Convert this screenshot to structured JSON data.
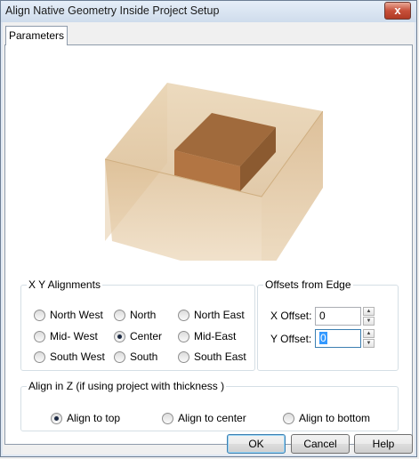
{
  "window": {
    "title": "Align Native Geometry Inside Project Setup",
    "close_glyph": "x"
  },
  "tabs": [
    {
      "label": "Parameters",
      "selected": true
    }
  ],
  "xy_alignments": {
    "legend": "X Y Alignments",
    "options": [
      {
        "label": "North West",
        "checked": false
      },
      {
        "label": "North",
        "checked": false
      },
      {
        "label": "North East",
        "checked": false
      },
      {
        "label": "Mid- West",
        "checked": false
      },
      {
        "label": "Center",
        "checked": true
      },
      {
        "label": "Mid-East",
        "checked": false
      },
      {
        "label": "South West",
        "checked": false
      },
      {
        "label": "South",
        "checked": false
      },
      {
        "label": "South East",
        "checked": false
      }
    ]
  },
  "offsets": {
    "legend": "Offsets from Edge",
    "x_label": "X Offset:",
    "x_value": "0",
    "y_label": "Y Offset:",
    "y_value": "0"
  },
  "align_z": {
    "legend": "Align in Z (if using project with thickness )",
    "options": [
      {
        "label": "Align to top",
        "checked": true
      },
      {
        "label": "Align to center",
        "checked": false
      },
      {
        "label": "Align to bottom",
        "checked": false
      }
    ]
  },
  "buttons": {
    "ok": "OK",
    "cancel": "Cancel",
    "help": "Help"
  },
  "icons": {
    "preview": "box-in-box-3d-illustration",
    "spin_up": "up-arrow-icon",
    "spin_down": "down-arrow-icon"
  }
}
